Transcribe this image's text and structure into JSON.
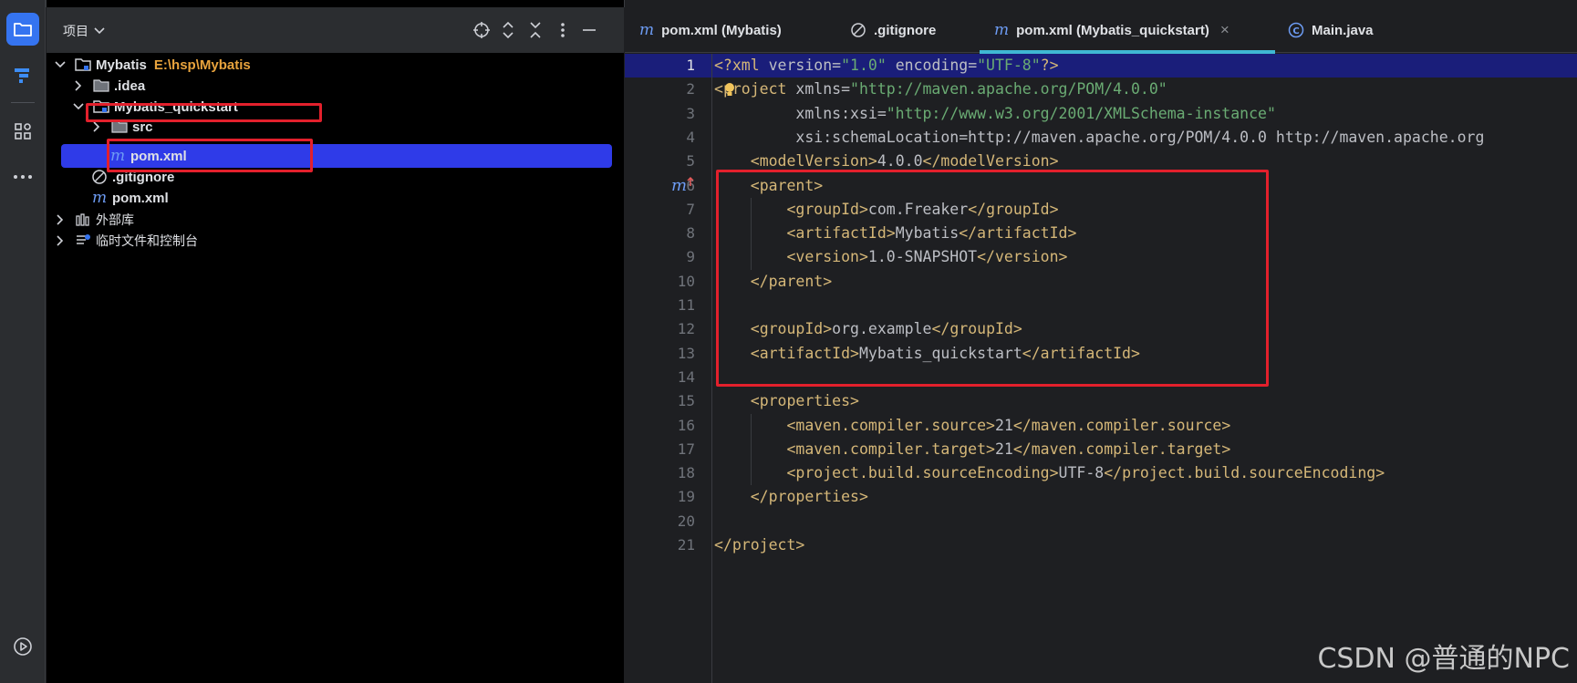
{
  "project_panel": {
    "title": "项目",
    "tree": [
      {
        "name": "Mybatis",
        "path": "E:\\hsp\\Mybatis",
        "expanded": true
      },
      {
        "name": ".idea",
        "expanded": false
      },
      {
        "name": "Mybatis_quickstart",
        "expanded": true
      },
      {
        "name": "src",
        "expanded": false
      },
      {
        "name": "pom.xml",
        "selected": true
      },
      {
        "name": ".gitignore"
      },
      {
        "name": "pom.xml"
      },
      {
        "name": "外部库",
        "expanded": false
      },
      {
        "name": "临时文件和控制台",
        "expanded": false
      }
    ]
  },
  "tabs": [
    {
      "label": "pom.xml (Mybatis)",
      "icon": "maven-icon"
    },
    {
      "label": ".gitignore",
      "icon": "gitignore-icon"
    },
    {
      "label": "pom.xml (Mybatis_quickstart)",
      "icon": "maven-icon",
      "active": true,
      "close": "×"
    },
    {
      "label": "Main.java",
      "icon": "java-class-icon"
    }
  ],
  "editor": {
    "line_numbers": [
      "1",
      "2",
      "3",
      "4",
      "5",
      "6",
      "7",
      "8",
      "9",
      "10",
      "11",
      "12",
      "13",
      "14",
      "15",
      "16",
      "17",
      "18",
      "19",
      "20",
      "21"
    ],
    "current_line": 1,
    "lines": [
      "<?xml version=\"1.0\" encoding=\"UTF-8\"?>",
      "<project xmlns=\"http://maven.apache.org/POM/4.0.0\"",
      "         xmlns:xsi=\"http://www.w3.org/2001/XMLSchema-instance\"",
      "         xsi:schemaLocation=\"http://maven.apache.org/POM/4.0.0 http://maven.apache.org",
      "    <modelVersion>4.0.0</modelVersion>",
      "    <parent>",
      "        <groupId>com.Freaker</groupId>",
      "        <artifactId>Mybatis</artifactId>",
      "        <version>1.0-SNAPSHOT</version>",
      "    </parent>",
      "",
      "    <groupId>org.example</groupId>",
      "    <artifactId>Mybatis_quickstart</artifactId>",
      "",
      "    <properties>",
      "        <maven.compiler.source>21</maven.compiler.source>",
      "        <maven.compiler.target>21</maven.compiler.target>",
      "        <project.build.sourceEncoding>UTF-8</project.build.sourceEncoding>",
      "    </properties>",
      "",
      "</project>"
    ]
  },
  "colors": {
    "accent": "#3574f0",
    "selection": "#2f3be8",
    "highlight_box": "#e3202c",
    "xml_tag": "#d5b778",
    "xml_value": "#6aab73",
    "xml_namespace": "#c77dbb"
  },
  "watermark": "CSDN @普通的NPC"
}
